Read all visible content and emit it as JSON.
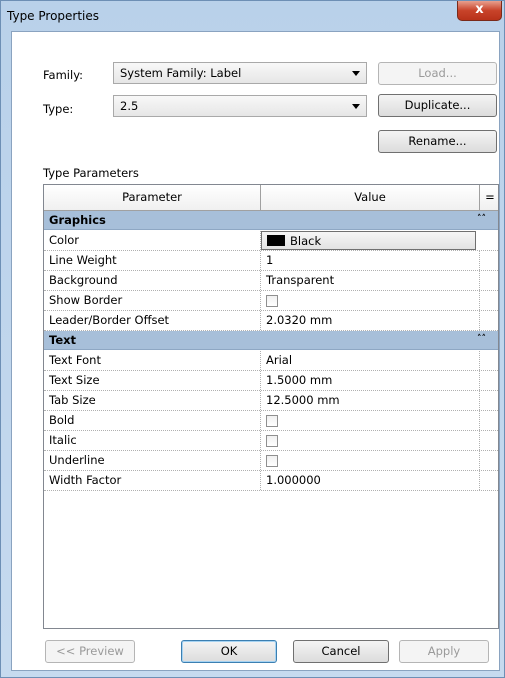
{
  "window": {
    "title": "Type Properties",
    "close_glyph": "x"
  },
  "family": {
    "label": "Family:",
    "value": "System Family: Label",
    "load_label": "Load..."
  },
  "type": {
    "label": "Type:",
    "value": "2.5",
    "duplicate_label": "Duplicate...",
    "rename_label": "Rename..."
  },
  "section_title": "Type Parameters",
  "table": {
    "col_parameter": "Parameter",
    "col_value": "Value",
    "col_extra": "=",
    "groups": [
      {
        "name": "Graphics",
        "collapse_glyph": "˄˄",
        "rows": [
          {
            "param": "Color",
            "value": "Black"
          },
          {
            "param": "Line Weight",
            "value": "1"
          },
          {
            "param": "Background",
            "value": "Transparent"
          },
          {
            "param": "Show Border",
            "value": ""
          },
          {
            "param": "Leader/Border Offset",
            "value": "2.0320 mm"
          }
        ]
      },
      {
        "name": "Text",
        "collapse_glyph": "˄˄",
        "rows": [
          {
            "param": "Text Font",
            "value": "Arial"
          },
          {
            "param": "Text Size",
            "value": "1.5000 mm"
          },
          {
            "param": "Tab Size",
            "value": "12.5000 mm"
          },
          {
            "param": "Bold",
            "value": ""
          },
          {
            "param": "Italic",
            "value": ""
          },
          {
            "param": "Underline",
            "value": ""
          },
          {
            "param": "Width Factor",
            "value": "1.000000"
          }
        ]
      }
    ]
  },
  "buttons": {
    "preview": "<< Preview",
    "ok": "OK",
    "cancel": "Cancel",
    "apply": "Apply"
  },
  "colors": {
    "group_header": "#a7bfd9",
    "frame": "#b9d1ea",
    "close": "#c8432a"
  }
}
